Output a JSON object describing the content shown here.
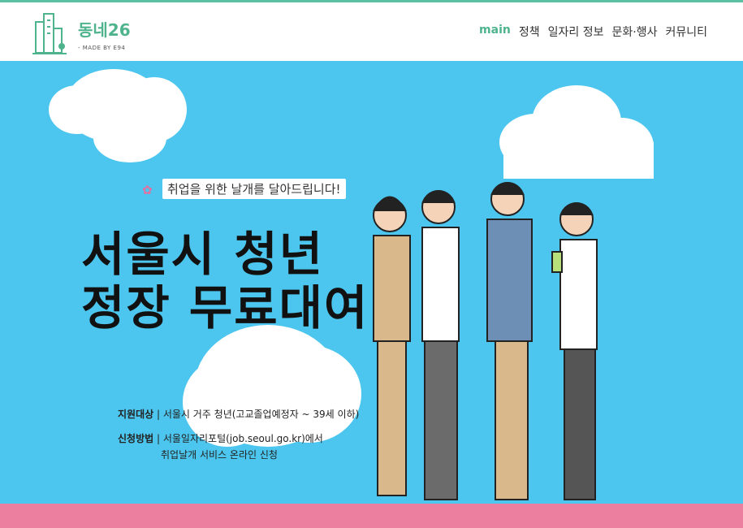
{
  "brand": {
    "name": "동네26",
    "sub": "- MADE BY E94"
  },
  "nav": {
    "items": [
      "main",
      "정책",
      "일자리 정보",
      "문화·행사",
      "커뮤니티"
    ]
  },
  "hero": {
    "tagline": "취업을 위한 날개를 달아드립니다!",
    "title_line1": "서울시 청년",
    "title_line2": "정장 무료대여",
    "info1_label": "지원대상",
    "info1_text": "서울시 거주 청년(고교졸업예정자 ~ 39세 이하)",
    "info2_label": "신청방법",
    "info2_text": "서울일자리포털(job.seoul.go.kr)에서",
    "info2_text2": "취업날개 서비스 온라인 신청"
  },
  "colors": {
    "accent": "#4fb48d",
    "sky": "#4cc6ee",
    "pink": "#ec7fa0"
  }
}
